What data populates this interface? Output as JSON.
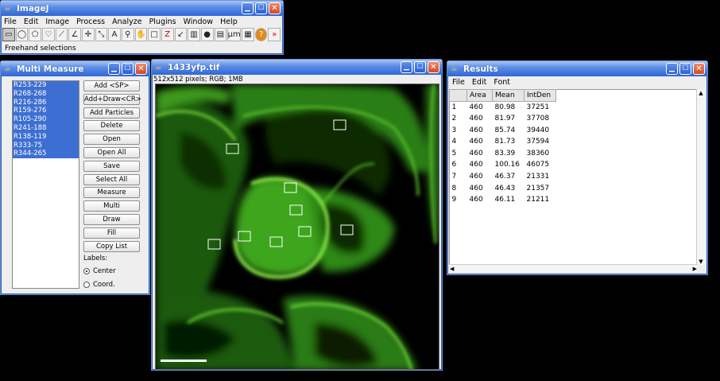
{
  "main": {
    "title": "ImageJ",
    "menu": [
      "File",
      "Edit",
      "Image",
      "Process",
      "Analyze",
      "Plugins",
      "Window",
      "Help"
    ],
    "tools": [
      {
        "icon": "rectangle-tool-icon",
        "glyph": "▭",
        "selected": true
      },
      {
        "icon": "oval-tool-icon",
        "glyph": "◯"
      },
      {
        "icon": "polygon-tool-icon",
        "glyph": "⬠"
      },
      {
        "icon": "freehand-tool-icon",
        "glyph": "♡"
      },
      {
        "icon": "straight-line-tool-icon",
        "glyph": "⟋"
      },
      {
        "icon": "angle-tool-icon",
        "glyph": "∠"
      },
      {
        "icon": "crosshair-tool-icon",
        "glyph": "✛"
      },
      {
        "icon": "wand-tool-icon",
        "glyph": "⤡"
      },
      {
        "icon": "text-tool-icon",
        "glyph": "A"
      },
      {
        "icon": "magnifier-tool-icon",
        "glyph": "⚲"
      },
      {
        "icon": "hand-tool-icon",
        "glyph": "✋"
      },
      {
        "icon": "color-picker-tool-icon",
        "glyph": "□"
      },
      {
        "icon": "z-tool-icon",
        "glyph": "Z"
      },
      {
        "icon": "arrow-tool-icon",
        "glyph": "↙"
      },
      {
        "icon": "histogram-tool-icon",
        "glyph": "▥"
      },
      {
        "icon": "color-wheel-tool-icon",
        "glyph": "●"
      },
      {
        "icon": "ruler-tool-icon",
        "glyph": "▤"
      },
      {
        "icon": "um-tool-icon",
        "glyph": "µm"
      },
      {
        "icon": "table-tool-icon",
        "glyph": "▦"
      },
      {
        "icon": "help-tool-icon",
        "glyph": "?"
      },
      {
        "icon": "more-tools-icon",
        "glyph": "»"
      }
    ],
    "status": "Freehand selections"
  },
  "multi": {
    "title": "Multi Measure",
    "rois": [
      "R253-229",
      "R268-268",
      "R216-286",
      "R159-276",
      "R105-290",
      "R241-188",
      "R138-119",
      "R333-75",
      "R344-265"
    ],
    "buttons": [
      "Add <SP>",
      "Add+Draw<CR>",
      "Add Particles",
      "Delete",
      "Open",
      "Open All",
      "Save",
      "Select All",
      "Measure",
      "Multi",
      "Draw",
      "Fill",
      "Copy List"
    ],
    "labels_caption": "Labels:",
    "radio_center": "Center",
    "radio_coord": "Coord."
  },
  "image": {
    "title": "1433yfp.tif",
    "info": "512x512 pixels; RGB; 1MB"
  },
  "results": {
    "title": "Results",
    "menu": [
      "File",
      "Edit",
      "Font"
    ],
    "columns": [
      " ",
      "Area",
      "Mean",
      "IntDen"
    ],
    "rows": [
      [
        "1",
        "460",
        "80.98",
        "37251"
      ],
      [
        "2",
        "460",
        "81.97",
        "37708"
      ],
      [
        "3",
        "460",
        "85.74",
        "39440"
      ],
      [
        "4",
        "460",
        "81.73",
        "37594"
      ],
      [
        "5",
        "460",
        "83.39",
        "38360"
      ],
      [
        "6",
        "460",
        "100.16",
        "46075"
      ],
      [
        "7",
        "460",
        "46.37",
        "21331"
      ],
      [
        "8",
        "460",
        "46.43",
        "21357"
      ],
      [
        "9",
        "460",
        "46.11",
        "21211"
      ]
    ]
  }
}
